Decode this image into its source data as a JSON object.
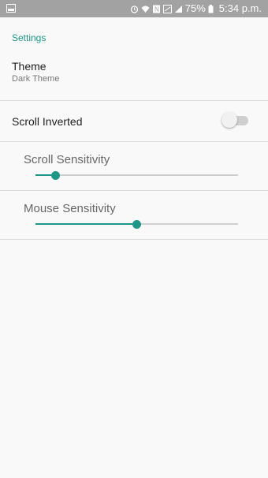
{
  "status_bar": {
    "battery_percent": "75%",
    "time": "5:34 p.m.",
    "icons": [
      "image-icon",
      "alarm-icon",
      "wifi-icon",
      "nfc-icon",
      "sim-icon",
      "signal-icon",
      "battery-icon"
    ]
  },
  "settings": {
    "section_title": "Settings",
    "theme": {
      "title": "Theme",
      "summary": "Dark Theme"
    },
    "scroll_inverted": {
      "label": "Scroll Inverted",
      "enabled": false
    },
    "scroll_sensitivity": {
      "label": "Scroll Sensitivity",
      "value_fraction": 0.1
    },
    "mouse_sensitivity": {
      "label": "Mouse Sensitivity",
      "value_fraction": 0.5
    }
  },
  "colors": {
    "accent": "#1e9688",
    "status_bar": "#a2a2a2",
    "background": "#f9f9f9"
  }
}
